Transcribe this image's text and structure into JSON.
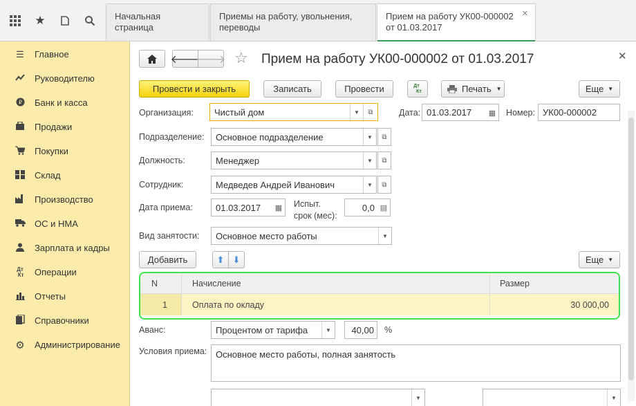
{
  "tabs": [
    {
      "label": "Начальная страница"
    },
    {
      "label": "Приемы на работу, увольнения, переводы"
    },
    {
      "label": "Прием на работу УК00-000002 от 01.03.2017"
    }
  ],
  "sidebar": {
    "items": [
      {
        "label": "Главное",
        "icon": "menu-icon"
      },
      {
        "label": "Руководителю",
        "icon": "trend-icon"
      },
      {
        "label": "Банк и касса",
        "icon": "coin-icon"
      },
      {
        "label": "Продажи",
        "icon": "cart-icon"
      },
      {
        "label": "Покупки",
        "icon": "basket-icon"
      },
      {
        "label": "Склад",
        "icon": "warehouse-icon"
      },
      {
        "label": "Производство",
        "icon": "factory-icon"
      },
      {
        "label": "ОС и НМА",
        "icon": "truck-icon"
      },
      {
        "label": "Зарплата и кадры",
        "icon": "people-icon"
      },
      {
        "label": "Операции",
        "icon": "dt-kt-icon"
      },
      {
        "label": "Отчеты",
        "icon": "bar-chart-icon"
      },
      {
        "label": "Справочники",
        "icon": "books-icon"
      },
      {
        "label": "Администрирование",
        "icon": "gear-icon"
      }
    ]
  },
  "doc": {
    "title": "Прием на работу УК00-000002 от 01.03.2017",
    "buttons": {
      "post_close": "Провести и закрыть",
      "save": "Записать",
      "post": "Провести",
      "print": "Печать",
      "more": "Еще"
    },
    "organization_label": "Организация:",
    "organization_value": "Чистый дом",
    "date_label": "Дата:",
    "date_value": "01.03.2017",
    "number_label": "Номер:",
    "number_value": "УК00-000002",
    "department_label": "Подразделение:",
    "department_value": "Основное подразделение",
    "position_label": "Должность:",
    "position_value": "Менеджер",
    "employee_label": "Сотрудник:",
    "employee_value": "Медведев Андрей Иванович",
    "hire_date_label": "Дата приема:",
    "hire_date_value": "01.03.2017",
    "probation_label_1": "Испыт.",
    "probation_label_2": "срок (мес):",
    "probation_value": "0,0",
    "employment_label": "Вид занятости:",
    "employment_value": "Основное место работы",
    "add_button": "Добавить",
    "more_button": "Еще",
    "table": {
      "headers": [
        "N",
        "Начисление",
        "Размер"
      ],
      "rows": [
        {
          "n": "1",
          "accrual": "Оплата по окладу",
          "amount": "30 000,00"
        }
      ]
    },
    "advance_label": "Аванс:",
    "advance_type": "Процентом от тарифа",
    "advance_value": "40,00",
    "advance_unit": "%",
    "conditions_label": "Условия приема:",
    "conditions_value": "Основное место работы, полная занятость"
  }
}
